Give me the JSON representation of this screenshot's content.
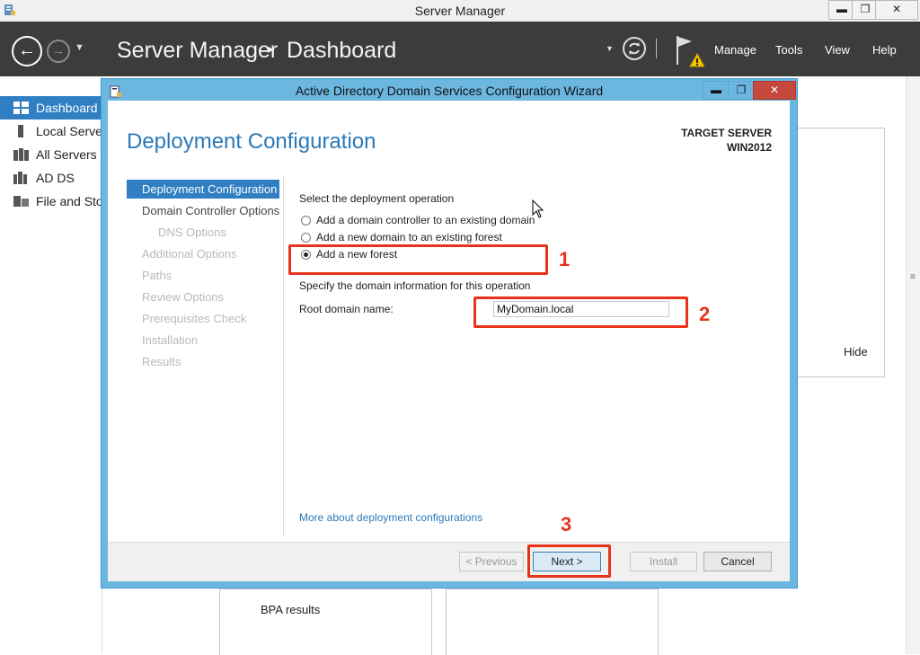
{
  "window": {
    "title": "Server Manager",
    "minimize": "▬",
    "maximize": "❐",
    "close": "✕"
  },
  "header": {
    "app_name": "Server Manager",
    "separator": "▸",
    "page": "Dashboard",
    "menu": [
      "Manage",
      "Tools",
      "View",
      "Help"
    ]
  },
  "sidebar": {
    "items": [
      {
        "label": "Dashboard",
        "icon": "grid-icon",
        "active": true
      },
      {
        "label": "Local Server",
        "icon": "server-icon"
      },
      {
        "label": "All Servers",
        "icon": "servers-icon"
      },
      {
        "label": "AD DS",
        "icon": "ad-ds-icon"
      },
      {
        "label": "File and Sto",
        "icon": "file-storage-icon"
      }
    ]
  },
  "background": {
    "hide_label": "Hide",
    "bpa_label": "BPA results"
  },
  "dialog": {
    "title": "Active Directory Domain Services Configuration Wizard",
    "heading": "Deployment Configuration",
    "target_label": "TARGET SERVER",
    "target_value": "WIN2012",
    "steps": [
      {
        "label": "Deployment Configuration",
        "state": "active"
      },
      {
        "label": "Domain Controller Options",
        "state": "enabled"
      },
      {
        "label": "DNS Options",
        "state": "disabled"
      },
      {
        "label": "Additional Options",
        "state": "disabled"
      },
      {
        "label": "Paths",
        "state": "disabled"
      },
      {
        "label": "Review Options",
        "state": "disabled"
      },
      {
        "label": "Prerequisites Check",
        "state": "disabled"
      },
      {
        "label": "Installation",
        "state": "disabled"
      },
      {
        "label": "Results",
        "state": "disabled"
      }
    ],
    "operation_label": "Select the deployment operation",
    "options": [
      {
        "label": "Add a domain controller to an existing domain",
        "checked": false
      },
      {
        "label": "Add a new domain to an existing forest",
        "checked": false
      },
      {
        "label": "Add a new forest",
        "checked": true
      }
    ],
    "domain_info_label": "Specify the domain information for this operation",
    "root_domain_label": "Root domain name:",
    "root_domain_value": "MyDomain.local",
    "more_link": "More about deployment configurations",
    "buttons": {
      "previous": "< Previous",
      "next": "Next >",
      "install": "Install",
      "cancel": "Cancel"
    }
  },
  "annotations": [
    "1",
    "2",
    "3"
  ],
  "colors": {
    "accent": "#2f7fc2",
    "annotation": "#e8331c",
    "header_bg": "#3c3c3c",
    "dialog_frame": "#6cb7e0"
  }
}
